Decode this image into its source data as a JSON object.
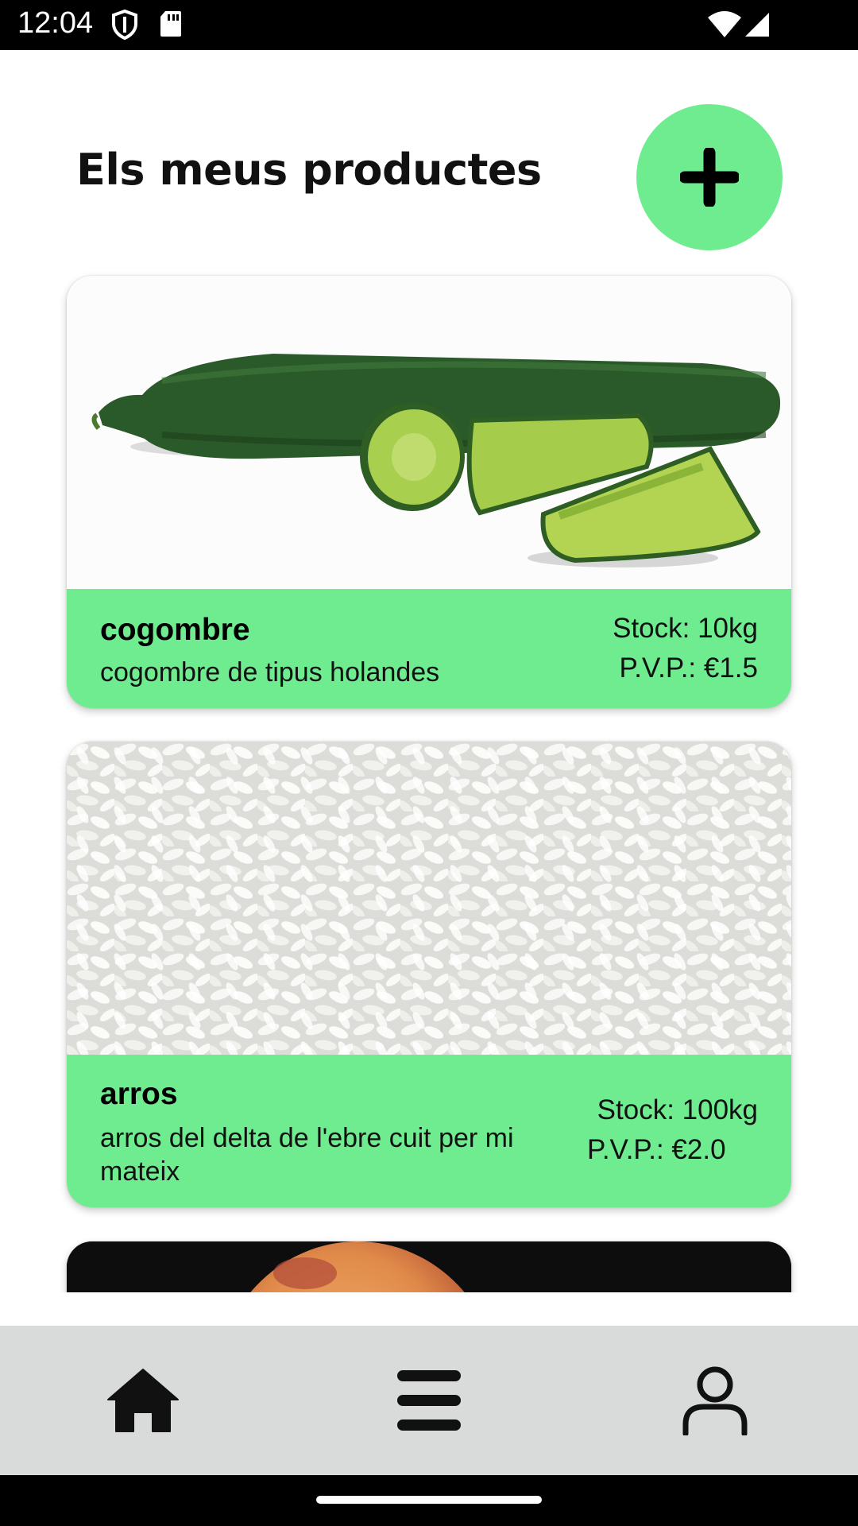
{
  "status_bar": {
    "time": "12:04",
    "icons": [
      "shield-icon",
      "sd-card-icon",
      "wifi-icon",
      "signal-icon"
    ]
  },
  "header": {
    "title": "Els meus productes",
    "add_button_icon": "plus-icon"
  },
  "colors": {
    "accent": "#6eec8f",
    "nav_background": "#d8dbd9",
    "text": "#111111"
  },
  "products": [
    {
      "name": "cogombre",
      "description": "cogombre de tipus holandes",
      "stock": "Stock: 10kg",
      "price": "P.V.P.: €1.5",
      "image": "cucumber-image"
    },
    {
      "name": "arros",
      "description": "arros del delta de l'ebre cuit per mi mateix",
      "stock": "Stock: 100kg",
      "price": "P.V.P.: €2.0",
      "image": "rice-image"
    },
    {
      "image": "peach-image"
    }
  ],
  "bottom_nav": {
    "items": [
      {
        "icon": "home-icon"
      },
      {
        "icon": "list-icon"
      },
      {
        "icon": "profile-icon"
      }
    ]
  }
}
